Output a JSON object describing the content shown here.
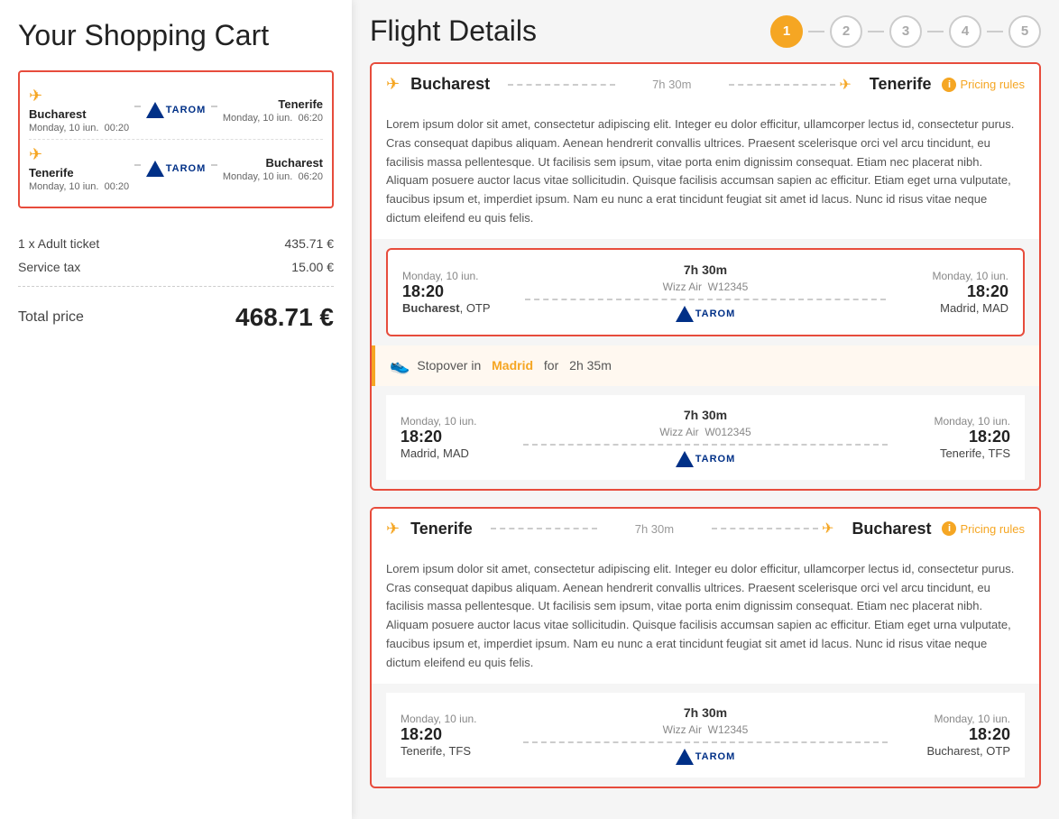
{
  "left": {
    "cart_title": "Your Shopping Cart",
    "flights": [
      {
        "from_city": "Bucharest",
        "from_date": "Monday, 10 iun.",
        "from_time": "00:20",
        "to_city": "Tenerife",
        "to_date": "Monday, 10 iun.",
        "to_time": "06:20",
        "airline": "TAROM"
      },
      {
        "from_city": "Tenerife",
        "from_date": "Monday, 10 iun.",
        "from_time": "00:20",
        "to_city": "Bucharest",
        "to_date": "Monday, 10 iun.",
        "to_time": "06:20",
        "airline": "TAROM"
      }
    ],
    "price_rows": [
      {
        "label": "1 x Adult ticket",
        "value": "435.71 €"
      },
      {
        "label": "Service tax",
        "value": "15.00 €"
      }
    ],
    "total_label": "Total price",
    "total_value": "468.71 €"
  },
  "right": {
    "title": "Flight Details",
    "steps": [
      {
        "num": "1",
        "active": true
      },
      {
        "num": "2",
        "active": false
      },
      {
        "num": "3",
        "active": false
      },
      {
        "num": "4",
        "active": false
      },
      {
        "num": "5",
        "active": false
      }
    ],
    "sections": [
      {
        "from": "Bucharest",
        "duration": "7h 30m",
        "to": "Tenerife",
        "pricing_rules": "Pricing rules",
        "lorem": "Lorem ipsum dolor sit amet, consectetur adipiscing elit. Integer eu dolor efficitur, ullamcorper lectus id, consectetur purus. Cras consequat dapibus aliquam. Aenean hendrerit convallis ultrices. Praesent scelerisque orci vel arcu tincidunt, eu facilisis massa pellentesque. Ut facilisis sem ipsum, vitae porta enim dignissim consequat. Etiam nec placerat nibh. Aliquam posuere auctor lacus vitae sollicitudin. Quisque facilisis accumsan sapien ac efficitur. Etiam eget urna vulputate, faucibus ipsum et, imperdiet ipsum. Nam eu nunc a erat tincidunt feugiat sit amet id lacus. Nunc id risus vitae neque dictum eleifend eu quis felis.",
        "legs": [
          {
            "dep_date": "Monday, 10 iun.",
            "dep_time": "18:20",
            "dep_city": "Bucharest",
            "dep_airport": "OTP",
            "duration": "7h 30m",
            "airline_name": "Wizz Air",
            "flight_no": "W12345",
            "arr_date": "Monday, 10 iun.",
            "arr_time": "18:20",
            "arr_city": "Madrid",
            "arr_airport": "MAD"
          }
        ],
        "stopover": {
          "city": "Madrid",
          "duration": "2h 35m"
        },
        "legs2": [
          {
            "dep_date": "Monday, 10 iun.",
            "dep_time": "18:20",
            "dep_city": "Madrid",
            "dep_airport": "MAD",
            "duration": "7h 30m",
            "airline_name": "Wizz Air",
            "flight_no": "W012345",
            "arr_date": "Monday, 10 iun.",
            "arr_time": "18:20",
            "arr_city": "Tenerife",
            "arr_airport": "TFS"
          }
        ]
      },
      {
        "from": "Tenerife",
        "duration": "7h 30m",
        "to": "Bucharest",
        "pricing_rules": "Pricing rules",
        "lorem": "Lorem ipsum dolor sit amet, consectetur adipiscing elit. Integer eu dolor efficitur, ullamcorper lectus id, consectetur purus. Cras consequat dapibus aliquam. Aenean hendrerit convallis ultrices. Praesent scelerisque orci vel arcu tincidunt, eu facilisis massa pellentesque. Ut facilisis sem ipsum, vitae porta enim dignissim consequat. Etiam nec placerat nibh. Aliquam posuere auctor lacus vitae sollicitudin. Quisque facilisis accumsan sapien ac efficitur. Etiam eget urna vulputate, faucibus ipsum et, imperdiet ipsum. Nam eu nunc a erat tincidunt feugiat sit amet id lacus. Nunc id risus vitae neque dictum eleifend eu quis felis.",
        "legs": [
          {
            "dep_date": "Monday, 10 iun.",
            "dep_time": "18:20",
            "dep_city": "Tenerife",
            "dep_airport": "TFS",
            "duration": "7h 30m",
            "airline_name": "Wizz Air",
            "flight_no": "W12345",
            "arr_date": "Monday, 10 iun.",
            "arr_time": "18:20",
            "arr_city": "Bucharest",
            "arr_airport": "OTP"
          }
        ]
      }
    ]
  }
}
